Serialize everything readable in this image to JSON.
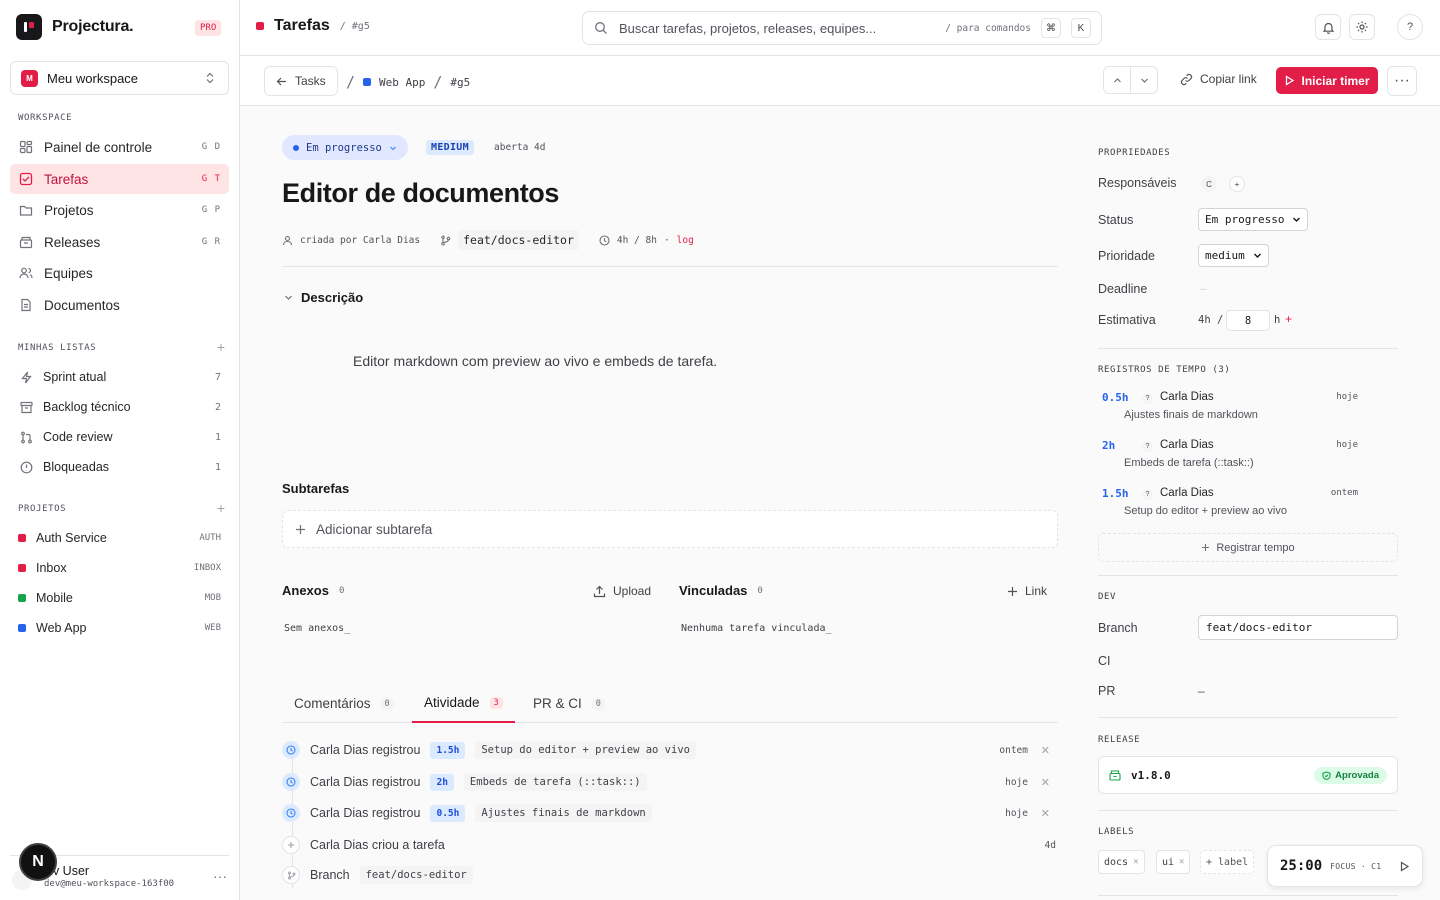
{
  "brand": {
    "name": "Projectura.",
    "plan": "PRO"
  },
  "workspace": {
    "badge": "M",
    "name": "Meu workspace"
  },
  "sidebar": {
    "section_workspace": "WORKSPACE",
    "nav": [
      {
        "label": "Painel de controle",
        "kbd": "G D"
      },
      {
        "label": "Tarefas",
        "kbd": "G T"
      },
      {
        "label": "Projetos",
        "kbd": "G P"
      },
      {
        "label": "Releases",
        "kbd": "G R"
      },
      {
        "label": "Equipes",
        "kbd": ""
      },
      {
        "label": "Documentos",
        "kbd": ""
      }
    ],
    "section_lists": "MINHAS LISTAS",
    "lists": [
      {
        "label": "Sprint atual",
        "count": "7"
      },
      {
        "label": "Backlog técnico",
        "count": "2"
      },
      {
        "label": "Code review",
        "count": "1"
      },
      {
        "label": "Bloqueadas",
        "count": "1"
      }
    ],
    "section_projects": "PROJETOS",
    "projects": [
      {
        "label": "Auth Service",
        "code": "AUTH",
        "color": "#e11d48"
      },
      {
        "label": "Inbox",
        "code": "INBOX",
        "color": "#e11d48"
      },
      {
        "label": "Mobile",
        "code": "MOB",
        "color": "#16a34a"
      },
      {
        "label": "Web App",
        "code": "WEB",
        "color": "#2563eb"
      }
    ],
    "user": {
      "name": "Dev User",
      "name_visible": "ev User",
      "email": "dev@meu-workspace-163f00",
      "overlay_badge": "N"
    }
  },
  "topbar": {
    "title": "Tarefas",
    "sub": "/ #g5",
    "search_placeholder": "Buscar tarefas, projetos, releases, equipes...",
    "search_hint": "/ para comandos",
    "key_cmd": "⌘",
    "key_k": "K",
    "help": "?"
  },
  "subbar": {
    "back_label": "Tasks",
    "crumb_project": "Web App",
    "crumb_task": "#g5",
    "copy_link": "Copiar link",
    "start_timer": "Iniciar timer"
  },
  "task": {
    "status": "Em progresso",
    "priority": "MEDIUM",
    "age": "aberta 4d",
    "title": "Editor de documentos",
    "created_by": "criada por Carla Dias",
    "branch": "feat/docs-editor",
    "time": "4h / 8h",
    "time_sep": "·",
    "log": "log",
    "description_heading": "Descrição",
    "description": "Editor markdown com preview ao vivo e embeds de tarefa.",
    "subtasks_heading": "Subtarefas",
    "subtasks_add": "Adicionar subtarefa",
    "attachments_heading": "Anexos",
    "attachments_count": "0",
    "upload": "Upload",
    "attachments_empty": "Sem anexos_",
    "linked_heading": "Vinculadas",
    "linked_count": "0",
    "link": "Link",
    "linked_empty": "Nenhuma tarefa vinculada_"
  },
  "tabs": [
    {
      "label": "Comentários",
      "count": "0"
    },
    {
      "label": "Atividade",
      "count": "3"
    },
    {
      "label": "PR & CI",
      "count": "0"
    }
  ],
  "activity": [
    {
      "text": "Carla Dias registrou",
      "hours": "1.5h",
      "note": "Setup do editor + preview ao vivo",
      "when": "ontem"
    },
    {
      "text": "Carla Dias registrou",
      "hours": "2h",
      "note": "Embeds de tarefa (::task::)",
      "when": "hoje"
    },
    {
      "text": "Carla Dias registrou",
      "hours": "0.5h",
      "note": "Ajustes finais de markdown",
      "when": "hoje"
    },
    {
      "text": "Carla Dias criou a tarefa",
      "when": "4d"
    },
    {
      "text": "Branch",
      "branch": "feat/docs-editor"
    }
  ],
  "properties": {
    "heading": "PROPRIEDADES",
    "assignees_label": "Responsáveis",
    "assignee_initial": "C",
    "add": "+",
    "status_label": "Status",
    "status_value": "Em progresso",
    "priority_label": "Prioridade",
    "priority_value": "medium",
    "deadline_label": "Deadline",
    "deadline_value": "—",
    "estimate_label": "Estimativa",
    "estimate_spent": "4h /",
    "estimate_value": "8",
    "estimate_unit": "h"
  },
  "time_logs": {
    "heading": "REGISTROS DE TEMPO (3)",
    "items": [
      {
        "hours": "0.5h",
        "who": "Carla Dias",
        "when": "hoje",
        "note": "Ajustes finais de markdown"
      },
      {
        "hours": "2h",
        "who": "Carla Dias",
        "when": "hoje",
        "note": "Embeds de tarefa (::task::)"
      },
      {
        "hours": "1.5h",
        "who": "Carla Dias",
        "when": "ontem",
        "note": "Setup do editor + preview ao vivo"
      }
    ],
    "register": "Registrar tempo"
  },
  "dev": {
    "heading": "DEV",
    "branch_label": "Branch",
    "branch_value": "feat/docs-editor",
    "ci_label": "CI",
    "pr_label": "PR",
    "pr_value": "–"
  },
  "release": {
    "heading": "RELEASE",
    "version": "v1.8.0",
    "state": "Aprovada"
  },
  "labels": {
    "heading": "LABELS",
    "items": [
      "docs",
      "ui"
    ],
    "add": "+ label"
  },
  "focus": {
    "time": "25:00",
    "label": "FOCUS · C1"
  },
  "colors": {
    "accent": "#e11d48",
    "blue": "#2563eb",
    "green": "#16a34a"
  }
}
